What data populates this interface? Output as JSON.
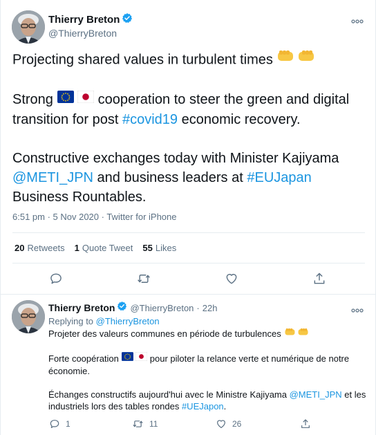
{
  "main_tweet": {
    "author_name": "Thierry Breton",
    "author_handle": "@ThierryBreton",
    "more_label": "ooo",
    "line1": "Projecting shared values in turbulent times",
    "p2_prefix": "Strong",
    "p2_middle": "cooperation to steer the green and digital transition for post",
    "p2_hashtag": "#covid19",
    "p2_suffix": "economic recovery.",
    "p3_prefix": "Constructive exchanges today with Minister Kajiyama",
    "p3_mention": "@METI_JPN",
    "p3_middle": "and business leaders at",
    "p3_hashtag": "#EUJapan",
    "p3_suffix": "Business Rountables.",
    "meta": "6:51 pm · 5 Nov 2020 · Twitter for iPhone",
    "stats": {
      "retweets_count": "20",
      "retweets_label": "Retweets",
      "quotes_count": "1",
      "quotes_label": "Quote Tweet",
      "likes_count": "55",
      "likes_label": "Likes"
    }
  },
  "reply_tweet": {
    "author_name": "Thierry Breton",
    "author_handle": "@ThierryBreton",
    "separator": "·",
    "time": "22h",
    "more_label": "ooo",
    "replying_prefix": "Replying to",
    "replying_to": "@ThierryBreton",
    "line1": "Projeter des valeurs communes en période de turbulences",
    "p2_prefix": "Forte coopération",
    "p2_suffix": "pour piloter la relance verte et numérique de notre économie.",
    "p3_prefix": "Échanges constructifs aujourd'hui avec le Ministre Kajiyama",
    "p3_mention": "@METI_JPN",
    "p3_middle": "et les industriels lors des tables rondes",
    "p3_hashtag": "#UEJapon",
    "p3_suffix": ".",
    "reply_count": "1",
    "retweet_count": "11",
    "like_count": "26"
  },
  "icons": [
    "verified-icon",
    "more-icon",
    "reply-icon",
    "retweet-icon",
    "like-icon",
    "share-icon",
    "eu-flag-icon",
    "japan-flag-icon",
    "fist-bump-icon"
  ],
  "colors": {
    "link": "#1b95e0",
    "secondary_text": "#5b7083",
    "verified": "#1da1f2",
    "divider": "#e6ecf0"
  }
}
